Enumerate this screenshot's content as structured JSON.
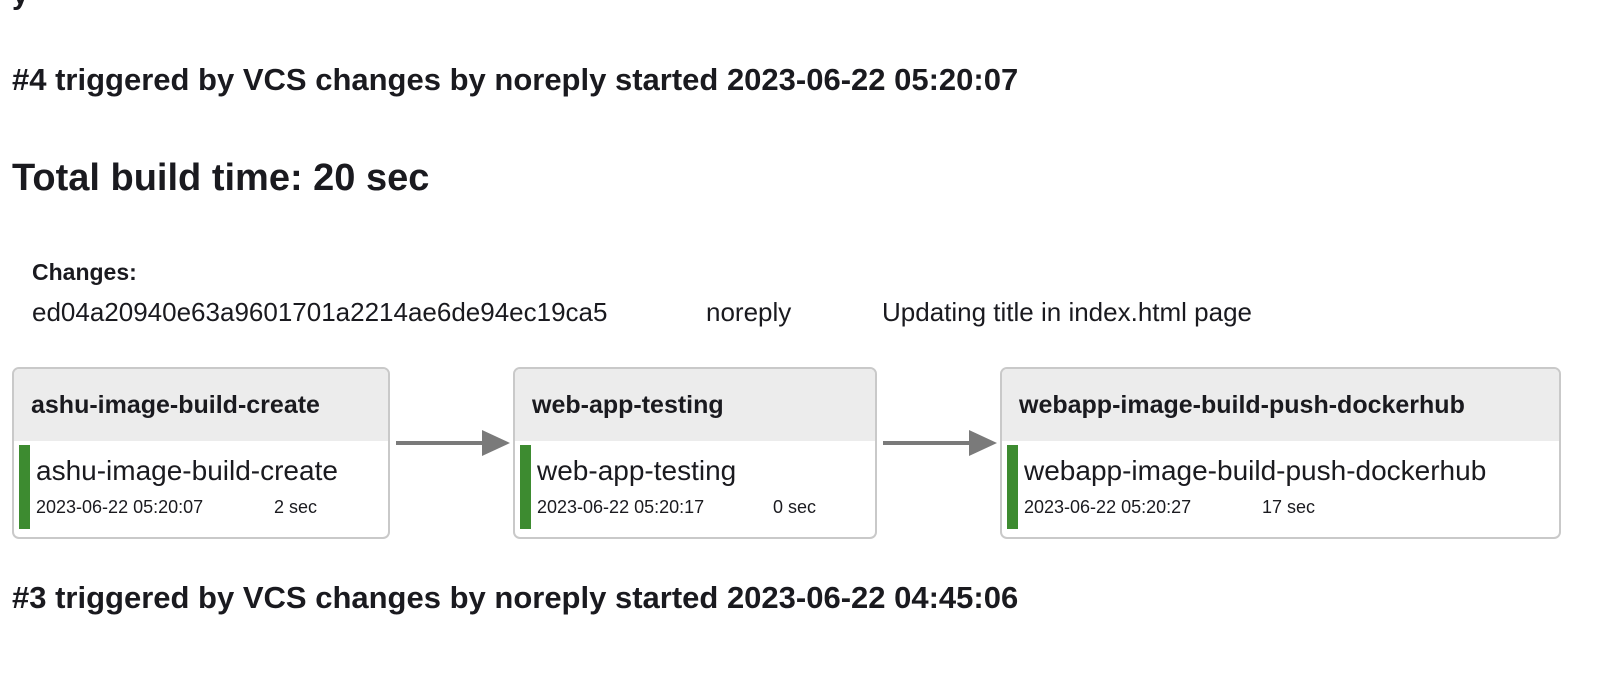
{
  "builds": {
    "build4": {
      "heading": "#4 triggered by VCS changes by noreply started 2023-06-22 05:20:07",
      "total_time": "Total build time: 20 sec",
      "changes": {
        "label": "Changes:",
        "hash": "ed04a20940e63a9601701a2214ae6de94ec19ca5",
        "author": "noreply",
        "message": "Updating title in index.html page"
      },
      "pipeline": [
        {
          "job": "ashu-image-build-create",
          "stage": "ashu-image-build-create",
          "started": "2023-06-22 05:20:07",
          "duration": "2 sec",
          "status": "success"
        },
        {
          "job": "web-app-testing",
          "stage": "web-app-testing",
          "started": "2023-06-22 05:20:17",
          "duration": "0 sec",
          "status": "success"
        },
        {
          "job": "webapp-image-build-push-dockerhub",
          "stage": "webapp-image-build-push-dockerhub",
          "started": "2023-06-22 05:20:27",
          "duration": "17 sec",
          "status": "success"
        }
      ]
    },
    "build3": {
      "heading": "#3 triggered by VCS changes by noreply started 2023-06-22 04:45:06"
    }
  },
  "colors": {
    "success": "#3d8b30",
    "header_bg": "#ececec",
    "arrow": "#7a7a7a"
  }
}
